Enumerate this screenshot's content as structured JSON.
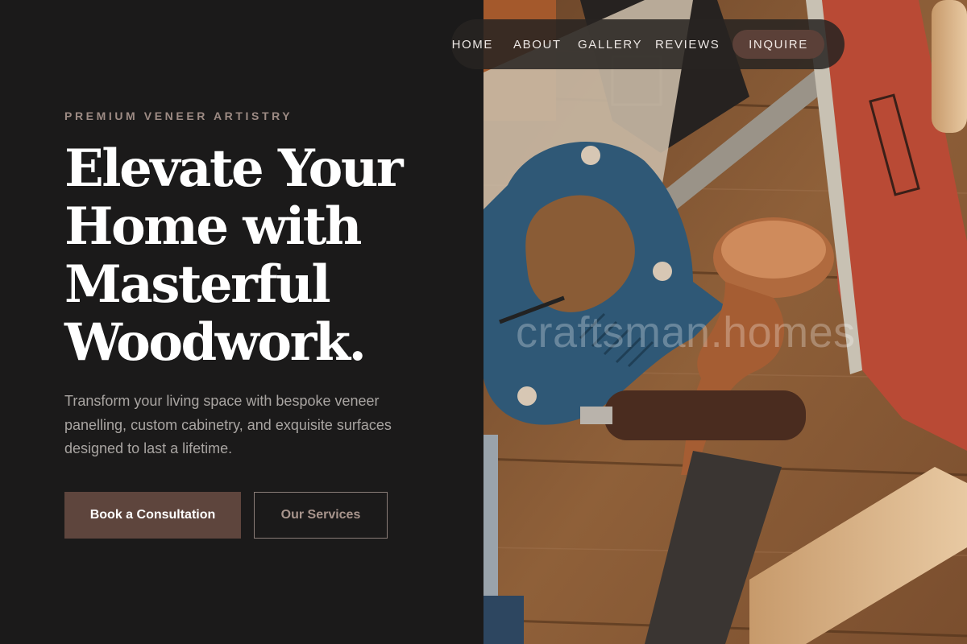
{
  "hero": {
    "eyebrow": "PREMIUM VENEER ARTISTRY",
    "headline_lines": [
      "Elevate Your",
      "Home with",
      "Masterful",
      "Woodwork."
    ],
    "subtext": "Transform your living space with bespoke veneer panelling, custom cabinetry, and exquisite surfaces designed to last a lifetime.",
    "primary_button": "Book a Consultation",
    "secondary_button": "Our Services"
  },
  "nav": {
    "partial_item": "HOME",
    "items": [
      "ABOUT",
      "GALLERY",
      "REVIEWS"
    ],
    "cta": "INQUIRE"
  },
  "image": {
    "watermark": "craftsman.homes",
    "description_icon": "woodworking-tools-photo"
  },
  "colors": {
    "panel_bg": "#1b1a1a",
    "accent": "#5e453d",
    "eyebrow": "#9d8b84",
    "body_text": "#a9a5a2"
  }
}
